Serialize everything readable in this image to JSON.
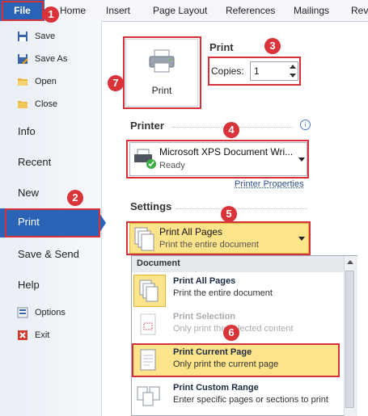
{
  "ribbon": {
    "file_tab": "File",
    "tabs": [
      "Home",
      "Insert",
      "Page Layout",
      "References",
      "Mailings",
      "Revi"
    ]
  },
  "left_menu": {
    "items_top": [
      {
        "label": "Save",
        "icon": "save-icon"
      },
      {
        "label": "Save As",
        "icon": "save-as-icon"
      },
      {
        "label": "Open",
        "icon": "open-folder-icon"
      },
      {
        "label": "Close",
        "icon": "close-folder-icon"
      }
    ],
    "items_big": [
      "Info",
      "Recent",
      "New",
      "Print",
      "Save & Send",
      "Help"
    ],
    "items_bottom": [
      {
        "label": "Options",
        "icon": "options-icon"
      },
      {
        "label": "Exit",
        "icon": "exit-icon"
      }
    ]
  },
  "print_panel": {
    "print_button_label": "Print",
    "print_heading": "Print",
    "copies_label": "Copies:",
    "copies_value": "1",
    "printer_heading": "Printer",
    "printer_name": "Microsoft XPS Document Wri...",
    "printer_status": "Ready",
    "printer_properties_link": "Printer Properties",
    "settings_heading": "Settings",
    "settings_selected_title": "Print All Pages",
    "settings_selected_sub": "Print the entire document"
  },
  "dropdown_list": {
    "header": "Document",
    "items": [
      {
        "title": "Print All Pages",
        "sub": "Print the entire document",
        "state": "normal"
      },
      {
        "title": "Print Selection",
        "sub": "Only print the selected content",
        "state": "disabled"
      },
      {
        "title": "Print Current Page",
        "sub": "Only print the current page",
        "state": "highlighted"
      },
      {
        "title": "Print Custom Range",
        "sub": "Enter specific pages or sections to print",
        "state": "normal"
      }
    ]
  },
  "callouts": [
    "1",
    "2",
    "3",
    "4",
    "5",
    "6",
    "7"
  ],
  "colors": {
    "accent_blue": "#2a63b6",
    "callout_red": "#d4313a",
    "highlight_yellow": "#fde38a"
  }
}
